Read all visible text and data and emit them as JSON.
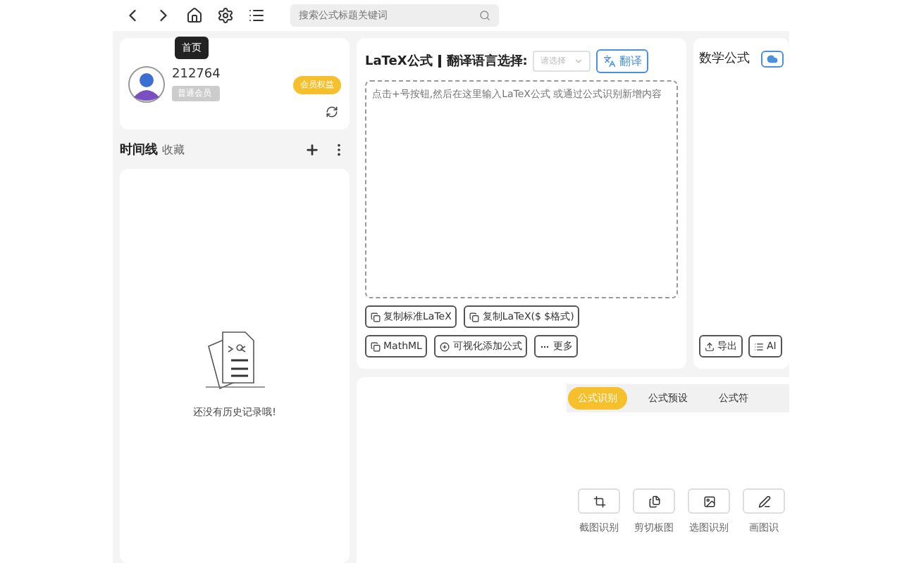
{
  "toolbar": {
    "search": {
      "placeholder": "搜索公式标题关键词"
    },
    "tooltip": "首页"
  },
  "profile": {
    "user_id": "212764",
    "level_badge": "普通会员",
    "benefits_button": "会员权益"
  },
  "timeline": {
    "tabs": [
      {
        "label": "时间线",
        "selected": true
      },
      {
        "label": "收藏",
        "selected": false
      }
    ],
    "empty_text": "还没有历史记录哦!"
  },
  "latex_panel": {
    "title": "LaTeX公式",
    "language_label": "翻译语言选择:",
    "language_select": {
      "placeholder": "请选择"
    },
    "translate_button": "翻译",
    "editor": {
      "placeholder": "点击+号按钮,然后在这里输入LaTeX公式 或通过公式识别新增内容"
    },
    "actions": [
      {
        "label": "复制标准LaTeX",
        "kind": "copy"
      },
      {
        "label": "复制LaTeX($ $格式)",
        "kind": "copy"
      },
      {
        "label": "MathML",
        "kind": "copy"
      },
      {
        "label": "可视化添加公式",
        "kind": "add"
      },
      {
        "label": "更多",
        "kind": "more"
      }
    ]
  },
  "math_panel": {
    "title": "数学公式",
    "actions": [
      {
        "label": "导出",
        "kind": "export"
      },
      {
        "label": "AI",
        "kind": "ai"
      }
    ]
  },
  "recognition_panel": {
    "tabs": [
      {
        "label": "公式识别",
        "selected": true
      },
      {
        "label": "公式预设",
        "selected": false
      },
      {
        "label": "公式符",
        "selected": false
      }
    ],
    "tools": [
      {
        "label": "截图识别",
        "kind": "crop"
      },
      {
        "label": "剪切板图",
        "kind": "clipboard"
      },
      {
        "label": "选图识别",
        "kind": "image"
      },
      {
        "label": "画图识",
        "kind": "draw"
      }
    ]
  }
}
